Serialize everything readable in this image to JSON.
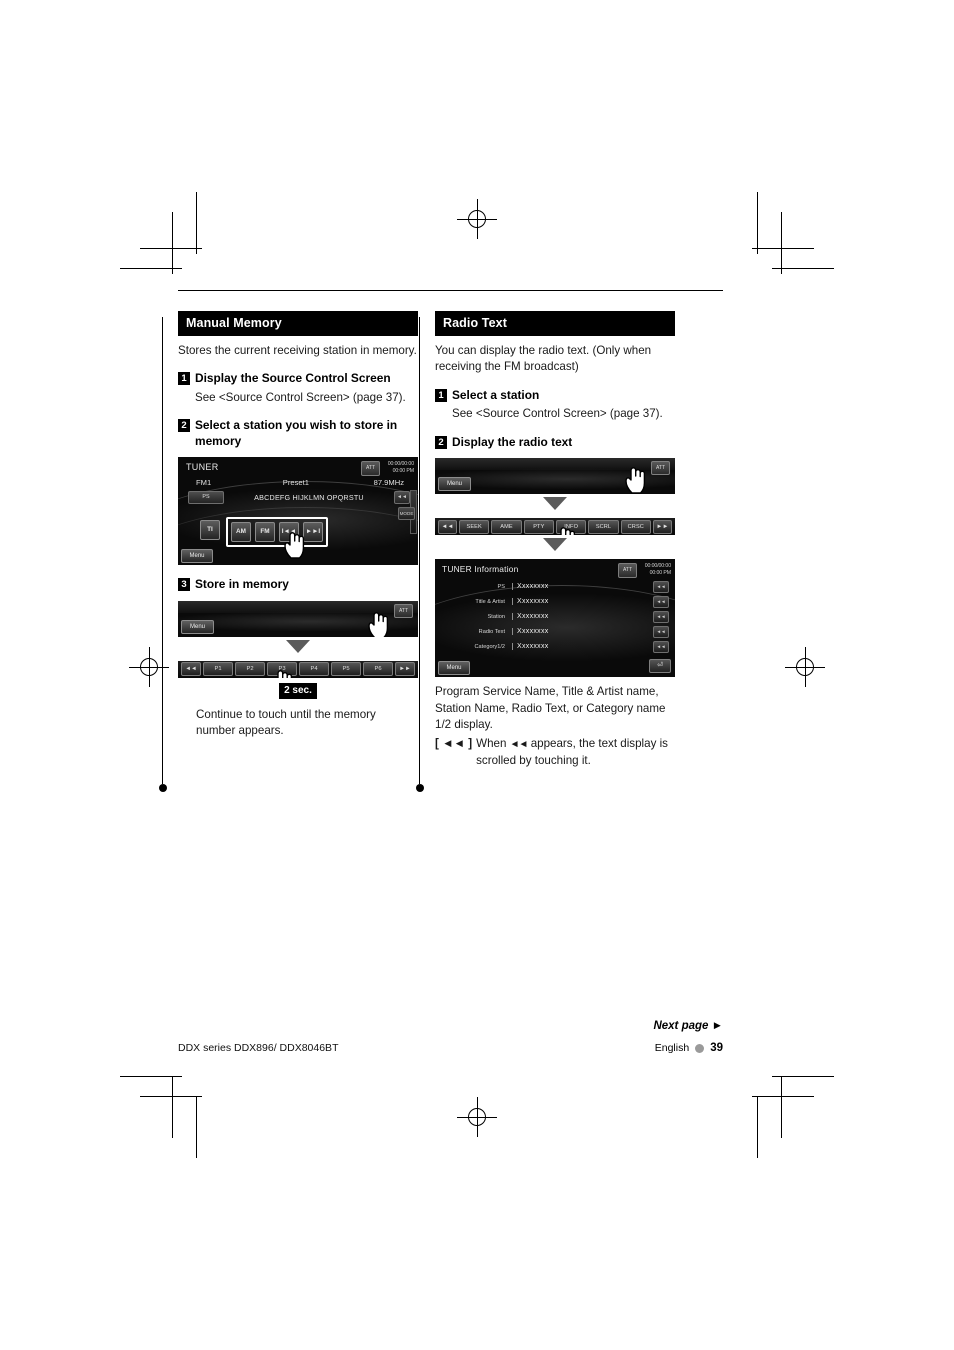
{
  "footer": {
    "next_page": "Next page ►",
    "model": "DDX series  DDX896/ DDX8046BT",
    "language": "English",
    "page_number": "39"
  },
  "left_column": {
    "section_title": "Manual Memory",
    "intro": "Stores the current receiving station in memory.",
    "steps": [
      {
        "number": "1",
        "title": "Display the Source Control Screen",
        "sub": "See <Source Control Screen> (page 37)."
      },
      {
        "number": "2",
        "title": "Select a station you wish to store in memory",
        "sub": ""
      },
      {
        "number": "3",
        "title": "Store in memory",
        "sub": ""
      }
    ],
    "tuner_screen": {
      "title": "TUNER",
      "clock_line1": "00:00/00:00",
      "clock_line2": "00:00 PM",
      "att_label": "ATT",
      "band": "FM1",
      "preset": "Preset1",
      "frequency": "87.9MHz",
      "ps_tag": "PS",
      "ps_value": "ABCDEFG HIJKLMN OPQRSTU",
      "ps_scroll": "◄◄",
      "keys": [
        "AM",
        "FM",
        "I◄◄",
        "►►I"
      ],
      "ti_key": "TI",
      "menu_label": "Menu",
      "side_button": "MODE"
    },
    "menu_strip": {
      "menu_label": "Menu",
      "att_label": "ATT"
    },
    "preset_bar": {
      "nav_left": "◄◄",
      "presets": [
        "P1",
        "P2",
        "P3",
        "P4",
        "P5",
        "P6"
      ],
      "nav_right": "►►"
    },
    "sec_badge": "2 sec.",
    "closing_note": "Continue to touch until the memory number appears."
  },
  "right_column": {
    "section_title": "Radio Text",
    "intro": "You can display the radio text. (Only when receiving the FM broadcast)",
    "steps": [
      {
        "number": "1",
        "title": "Select a station",
        "sub": "See <Source Control Screen> (page 37)."
      },
      {
        "number": "2",
        "title": "Display the radio text",
        "sub": ""
      }
    ],
    "menu_strip": {
      "menu_label": "Menu",
      "att_label": "ATT"
    },
    "function_bar": {
      "nav_left": "◄◄",
      "keys": [
        "SEEK",
        "AME",
        "PTY",
        "INFO",
        "SCRL",
        "CRSC"
      ],
      "nav_right": "►►"
    },
    "info_screen": {
      "title": "TUNER Information",
      "clock_line1": "00:00/00:00",
      "clock_line2": "00:00 PM",
      "att_label": "ATT",
      "rows": [
        {
          "label": "PS",
          "value": "Xxxxxxxx",
          "scroll": "◄◄"
        },
        {
          "label": "Title & Artist",
          "value": "Xxxxxxxx",
          "scroll": "◄◄"
        },
        {
          "label": "Station",
          "value": "Xxxxxxxx",
          "scroll": "◄◄"
        },
        {
          "label": "Radio Text",
          "value": "Xxxxxxxx",
          "scroll": "◄◄"
        },
        {
          "label": "Category1/2",
          "value": "Xxxxxxxx",
          "scroll": "◄◄"
        }
      ],
      "menu_label": "Menu",
      "back_label": "⏎"
    },
    "caption": "Program Service Name, Title & Artist name, Station Name, Radio Text, or Category name 1/2 display.",
    "note_bracket": "[ ◄◄ ]",
    "note_text_1": "When",
    "note_glyph": "◄◄",
    "note_text_2": "appears, the text display is scrolled by touching it."
  }
}
